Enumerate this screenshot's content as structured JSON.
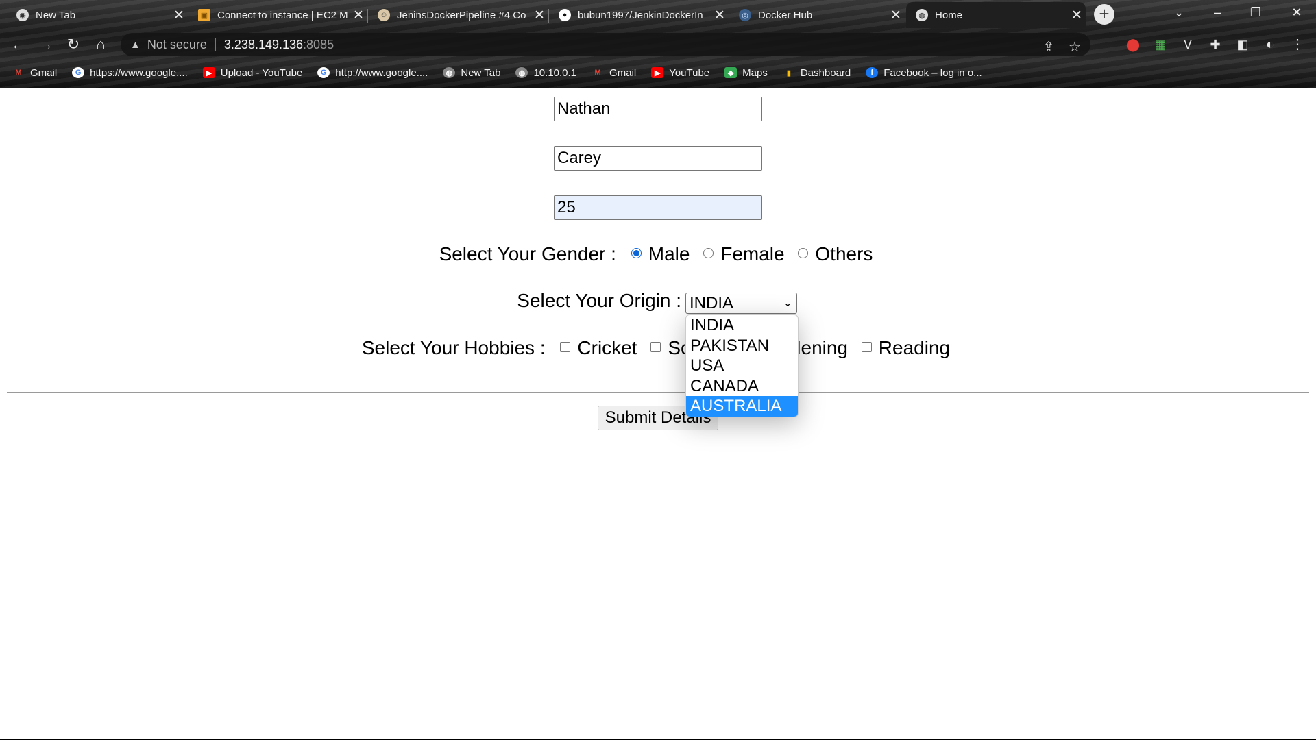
{
  "tabs": [
    {
      "title": "New Tab",
      "icon": "chrome-icon"
    },
    {
      "title": "Connect to instance | EC2 M",
      "icon": "aws-icon"
    },
    {
      "title": "JeninsDockerPipeline #4 Co",
      "icon": "jenkins-icon"
    },
    {
      "title": "bubun1997/JenkinDockerIn",
      "icon": "github-icon"
    },
    {
      "title": "Docker Hub",
      "icon": "docker-icon"
    },
    {
      "title": "Home",
      "icon": "globe-icon",
      "active": true
    }
  ],
  "address_bar": {
    "security": "Not secure",
    "host": "3.238.149.136",
    "port": ":8085"
  },
  "bookmarks": [
    {
      "label": "Gmail",
      "icon": "gmail-icon"
    },
    {
      "label": "https://www.google....",
      "icon": "google-icon"
    },
    {
      "label": "Upload - YouTube",
      "icon": "youtube-icon"
    },
    {
      "label": "http://www.google....",
      "icon": "google-icon"
    },
    {
      "label": "New Tab",
      "icon": "globe-icon"
    },
    {
      "label": "10.10.0.1",
      "icon": "globe-icon"
    },
    {
      "label": "Gmail",
      "icon": "gmail-icon"
    },
    {
      "label": "YouTube",
      "icon": "youtube-icon"
    },
    {
      "label": "Maps",
      "icon": "maps-icon"
    },
    {
      "label": "Dashboard",
      "icon": "dashboard-icon"
    },
    {
      "label": "Facebook – log in o...",
      "icon": "facebook-icon"
    }
  ],
  "form": {
    "first_name": "Nathan",
    "last_name": "Carey",
    "age": "25",
    "gender_label": "Select Your Gender :",
    "gender_options": [
      "Male",
      "Female",
      "Others"
    ],
    "gender_selected": "Male",
    "origin_label": "Select Your Origin :",
    "origin_selected": "INDIA",
    "origin_options": [
      "INDIA",
      "PAKISTAN",
      "USA",
      "CANADA",
      "AUSTRALIA"
    ],
    "origin_highlighted": "AUSTRALIA",
    "hobbies_label": "Select Your Hobbies :",
    "hobbies": [
      "Cricket",
      "Soccer",
      "Gardening",
      "Reading"
    ],
    "submit_label": "Submit Details"
  },
  "colors": {
    "accent": "#1e90ff",
    "radio_selected": "#0a66d8",
    "autofill_bg": "#e8f0fe"
  }
}
